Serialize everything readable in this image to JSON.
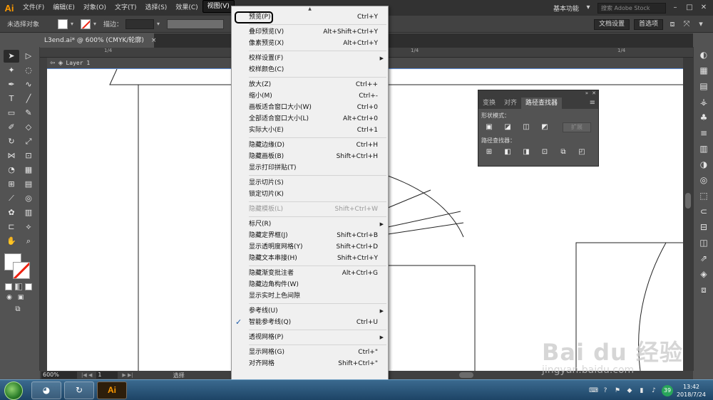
{
  "app": {
    "logo": "Ai"
  },
  "menubar": {
    "items": [
      "文件(F)",
      "编辑(E)",
      "对象(O)",
      "文字(T)",
      "选择(S)",
      "效果(C)",
      "视图(V)"
    ],
    "active_index": 6,
    "workspace": "基本功能",
    "stock_placeholder": "搜索 Adobe Stock"
  },
  "controlbar": {
    "selection": "未选择对象",
    "stroke_label": "描边：",
    "doc_settings": "文档设置",
    "preferences": "首选项"
  },
  "document": {
    "tab_title": "L3end.ai* @ 600% (CMYK/轮廓)",
    "close_glyph": "×",
    "layer_name": "Layer 1",
    "ruler_marks": [
      "1/4",
      "1/4",
      "1/4"
    ]
  },
  "statusbar": {
    "zoom": "600%",
    "page": "1",
    "status": "选择"
  },
  "panel": {
    "tabs": [
      "变换",
      "对齐",
      "路径查找器"
    ],
    "active_tab": 2,
    "shape_modes_label": "形状模式：",
    "pathfinders_label": "路径查找器：",
    "expand_label": "扩展"
  },
  "view_menu": {
    "items": [
      {
        "label": "预览(P)",
        "shortcut": "Ctrl+Y",
        "highlighted": true
      },
      {
        "sep": true
      },
      {
        "label": "叠印预览(V)",
        "shortcut": "Alt+Shift+Ctrl+Y"
      },
      {
        "label": "像素预览(X)",
        "shortcut": "Alt+Ctrl+Y"
      },
      {
        "sep": true
      },
      {
        "label": "校样设置(F)",
        "submenu": true
      },
      {
        "label": "校样颜色(C)"
      },
      {
        "sep": true
      },
      {
        "label": "放大(Z)",
        "shortcut": "Ctrl++"
      },
      {
        "label": "缩小(M)",
        "shortcut": "Ctrl+-"
      },
      {
        "label": "画板适合窗口大小(W)",
        "shortcut": "Ctrl+0"
      },
      {
        "label": "全部适合窗口大小(L)",
        "shortcut": "Alt+Ctrl+0"
      },
      {
        "label": "实际大小(E)",
        "shortcut": "Ctrl+1"
      },
      {
        "sep": true
      },
      {
        "label": "隐藏边缘(D)",
        "shortcut": "Ctrl+H"
      },
      {
        "label": "隐藏画板(B)",
        "shortcut": "Shift+Ctrl+H"
      },
      {
        "label": "显示打印拼贴(T)"
      },
      {
        "sep": true
      },
      {
        "label": "显示切片(S)"
      },
      {
        "label": "锁定切片(K)"
      },
      {
        "sep": true
      },
      {
        "label": "隐藏模板(L)",
        "shortcut": "Shift+Ctrl+W",
        "disabled": true
      },
      {
        "sep": true
      },
      {
        "label": "标尺(R)",
        "submenu": true
      },
      {
        "label": "隐藏定界框(J)",
        "shortcut": "Shift+Ctrl+B"
      },
      {
        "label": "显示透明度网格(Y)",
        "shortcut": "Shift+Ctrl+D"
      },
      {
        "label": "隐藏文本串接(H)",
        "shortcut": "Shift+Ctrl+Y"
      },
      {
        "sep": true
      },
      {
        "label": "隐藏渐变批注者",
        "shortcut": "Alt+Ctrl+G"
      },
      {
        "label": "隐藏边角构件(W)"
      },
      {
        "label": "显示实时上色间隙"
      },
      {
        "sep": true
      },
      {
        "label": "参考线(U)",
        "submenu": true
      },
      {
        "label": "智能参考线(Q)",
        "shortcut": "Ctrl+U",
        "checked": true
      },
      {
        "sep": true
      },
      {
        "label": "透视网格(P)",
        "submenu": true
      },
      {
        "sep": true
      },
      {
        "label": "显示网格(G)",
        "shortcut": "Ctrl+\""
      },
      {
        "label": "对齐网格",
        "shortcut": "Shift+Ctrl+\""
      }
    ]
  },
  "taskbar": {
    "ai_label": "Ai",
    "badge": "39",
    "time": "13:42",
    "date": "2018/7/24"
  },
  "watermark": {
    "logo": "Bai du 经验",
    "url": "jingyan.baidu.com"
  },
  "colors": {
    "accent": "#ff9a00",
    "menu_bg": "#f0f0f0",
    "ui_dark": "#323232",
    "ui_mid": "#535353"
  }
}
